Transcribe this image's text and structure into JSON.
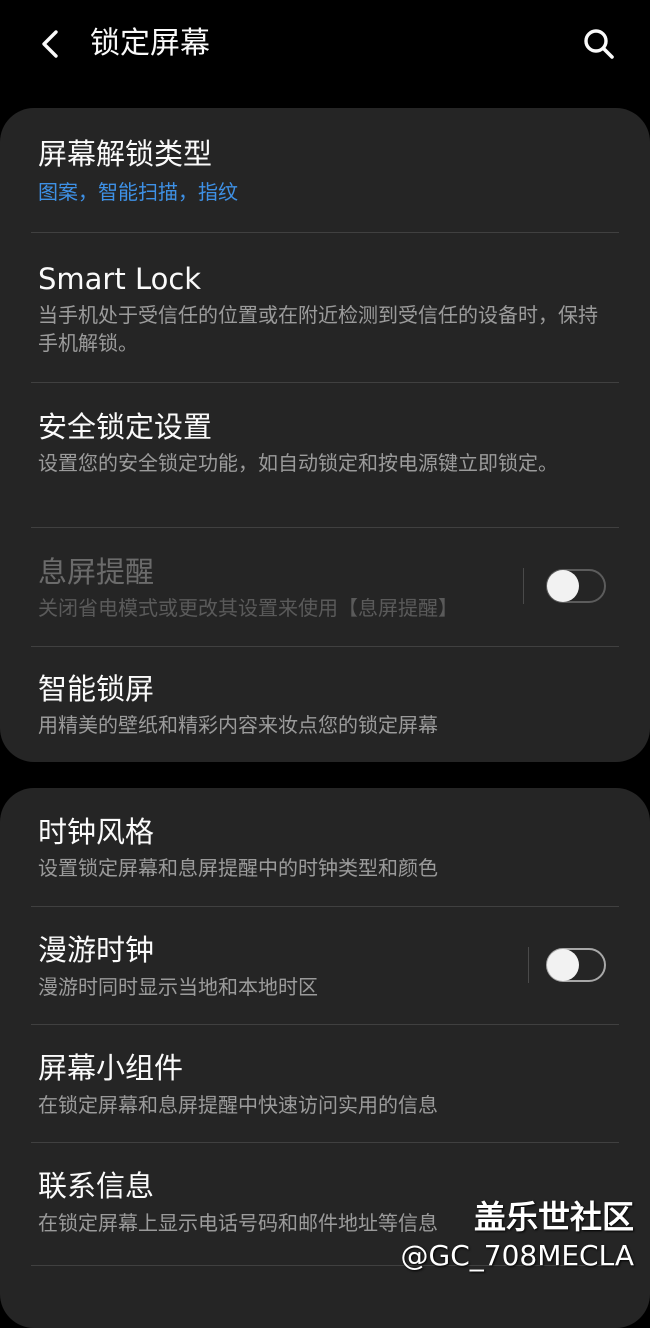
{
  "header": {
    "title": "锁定屏幕",
    "back_icon": "chevron-left-icon",
    "search_icon": "search-icon"
  },
  "card1": {
    "items": [
      {
        "title": "屏幕解锁类型",
        "subtitle": "图案，智能扫描，指纹"
      },
      {
        "title": "Smart Lock",
        "subtitle": "当手机处于受信任的位置或在附近检测到受信任的设备时，保持手机解锁。"
      },
      {
        "title": "安全锁定设置",
        "subtitle": "设置您的安全锁定功能，如自动锁定和按电源键立即锁定。"
      },
      {
        "title": "息屏提醒",
        "subtitle": "关闭省电模式或更改其设置来使用【息屏提醒】",
        "toggle": "off",
        "enabled": false
      },
      {
        "title": "智能锁屏",
        "subtitle": "用精美的壁纸和精彩内容来妆点您的锁定屏幕"
      }
    ]
  },
  "card2": {
    "items": [
      {
        "title": "时钟风格",
        "subtitle": "设置锁定屏幕和息屏提醒中的时钟类型和颜色"
      },
      {
        "title": "漫游时钟",
        "subtitle": "漫游时同时显示当地和本地时区",
        "toggle": "off"
      },
      {
        "title": "屏幕小组件",
        "subtitle": "在锁定屏幕和息屏提醒中快速访问实用的信息"
      },
      {
        "title": "联系信息",
        "subtitle": "在锁定屏幕上显示电话号码和邮件地址等信息"
      }
    ]
  },
  "watermark": {
    "title": "盖乐世社区",
    "user": "@GC_708MECLA"
  },
  "colors": {
    "background": "#000000",
    "card": "#252525",
    "accent": "#3e91e6",
    "secondary_text": "#9b9b9b"
  }
}
